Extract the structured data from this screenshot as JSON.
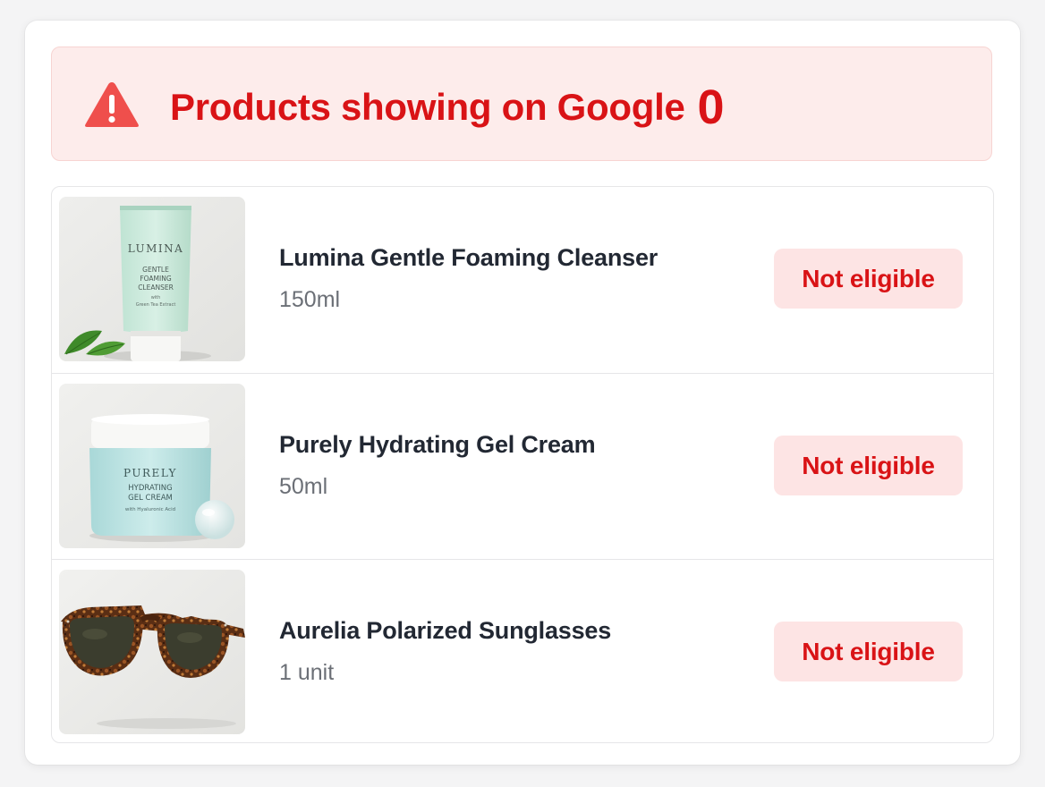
{
  "alert": {
    "title": "Products showing on Google",
    "count": "0",
    "icon": "warning-triangle-icon",
    "color": "#d91316"
  },
  "products": [
    {
      "name": "Lumina Gentle Foaming Cleanser",
      "size": "150ml",
      "status": "Not eligible",
      "image": {
        "brand": "LUMINA",
        "line1": "GENTLE",
        "line2": "FOAMING",
        "line3": "CLEANSER",
        "line4": "with",
        "line5": "Green Tea Extract"
      }
    },
    {
      "name": "Purely Hydrating Gel Cream",
      "size": "50ml",
      "status": "Not eligible",
      "image": {
        "brand": "PURELY",
        "line1": "HYDRATING",
        "line2": "GEL CREAM",
        "line3": "with Hyaluronic Acid"
      }
    },
    {
      "name": "Aurelia Polarized Sunglasses",
      "size": "1 unit",
      "status": "Not eligible",
      "image": {}
    }
  ]
}
